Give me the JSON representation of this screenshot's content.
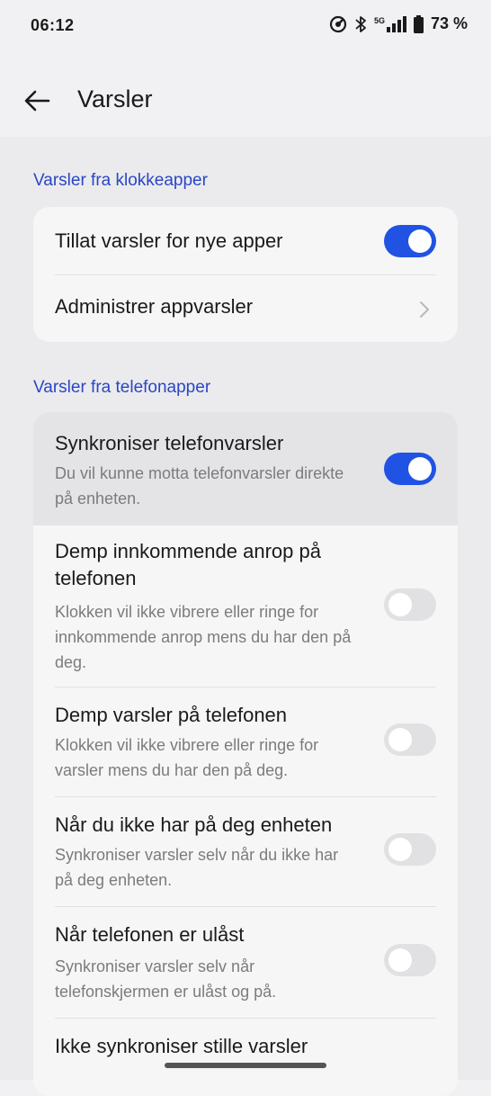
{
  "status_bar": {
    "time": "06:12",
    "network": "5G",
    "battery_text": "73 %",
    "icons": [
      "recording-icon",
      "bluetooth-icon",
      "signal-icon",
      "battery-icon"
    ]
  },
  "header": {
    "title": "Varsler",
    "back_icon": "back-arrow-icon"
  },
  "sections": {
    "watch_apps": {
      "label": "Varsler fra klokkeapper",
      "allow_new_apps": {
        "title": "Tillat varsler for nye apper",
        "enabled": true
      },
      "manage_app_notifications": {
        "title": "Administrer appvarsler"
      }
    },
    "phone_apps": {
      "label": "Varsler fra telefonapper",
      "sync_phone_notifications": {
        "title": "Synkroniser telefonvarsler",
        "subtitle": "Du vil kunne motta telefonvarsler direkte på enheten.",
        "enabled": true
      },
      "mute_incoming_calls": {
        "title": "Demp innkommende anrop på telefonen",
        "subtitle": "Klokken vil ikke vibrere eller ringe for innkommende anrop mens du har den på deg.",
        "enabled": false
      },
      "mute_notifications": {
        "title": "Demp varsler på telefonen",
        "subtitle": "Klokken vil ikke vibrere eller ringe for varsler mens du har den på deg.",
        "enabled": false
      },
      "not_wearing": {
        "title": "Når du ikke har på deg enheten",
        "subtitle": "Synkroniser varsler selv når du ikke har på deg enheten.",
        "enabled": false
      },
      "phone_unlocked": {
        "title": "Når telefonen er ulåst",
        "subtitle": "Synkroniser varsler selv når telefonskjermen er ulåst og på.",
        "enabled": false
      },
      "silent_notifications": {
        "title": "Ikke synkroniser stille varsler"
      }
    }
  },
  "colors": {
    "accent": "#2053e3",
    "section_label": "#2a46c4",
    "toggle_off": "#e1e1e3"
  }
}
